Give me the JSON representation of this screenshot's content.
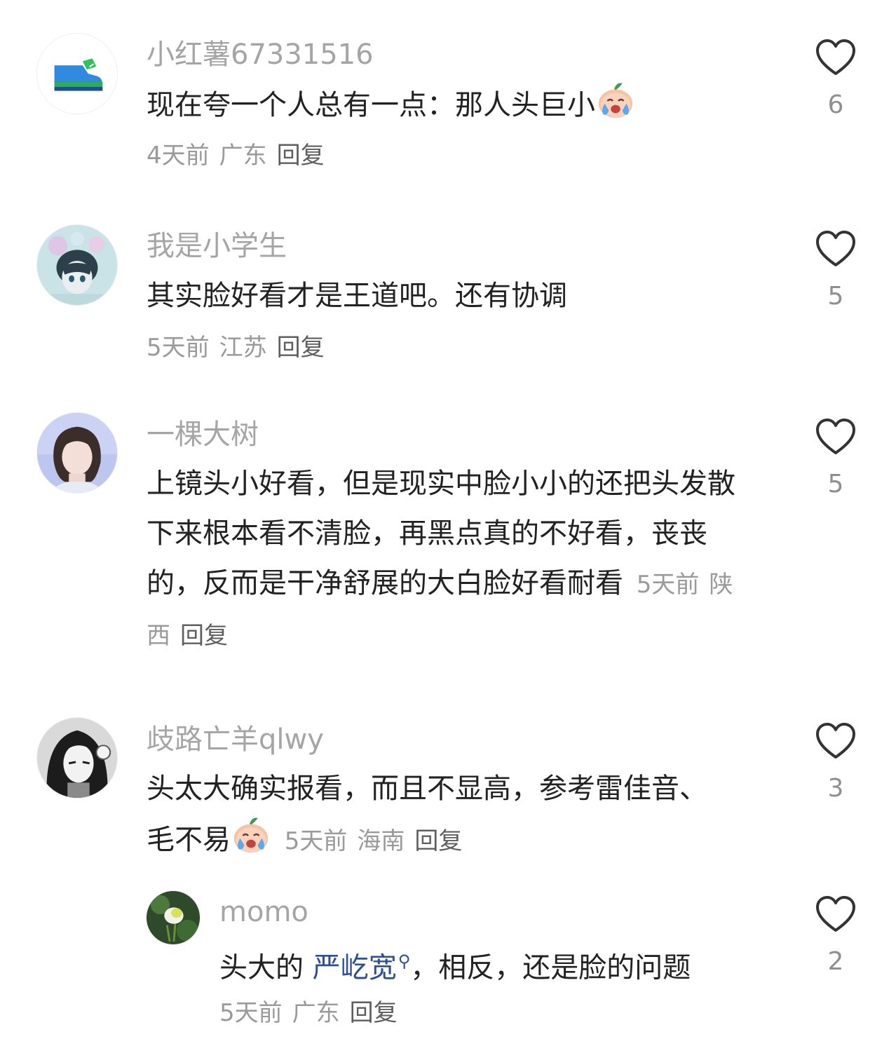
{
  "comments": [
    {
      "username": "小红薯67331516",
      "text": "现在夸一个人总有一点：那人头巨小",
      "time": "4天前",
      "location": "广东",
      "reply": "回复",
      "likes": "6",
      "avatar_icon": "sneaker-icon"
    },
    {
      "username": "我是小学生",
      "text": "其实脸好看才是王道吧。还有协调",
      "time": "5天前",
      "location": "江苏",
      "reply": "回复",
      "likes": "5",
      "avatar_icon": "anime-boy-avatar"
    },
    {
      "username": "一棵大树",
      "text": "上镜头小好看，但是现实中脸小小的还把头发散下来根本看不清脸，再黑点真的不好看，丧丧的，反而是干净舒展的大白脸好看耐看",
      "time": "5天前",
      "location": "陕西",
      "reply": "回复",
      "likes": "5",
      "avatar_icon": "girl-photo-avatar"
    },
    {
      "username": "歧路亡羊qlwy",
      "text": "头太大确实报看，而且不显高，参考雷佳音、毛不易",
      "time": "5天前",
      "location": "海南",
      "reply": "回复",
      "likes": "3",
      "avatar_icon": "manga-girl-avatar"
    }
  ],
  "reply_comment": {
    "username": "momo",
    "text_before": "头大的 ",
    "mention": "严屹宽",
    "text_after": "，相反，还是脸的问题",
    "time": "5天前",
    "location": "广东",
    "reply": "回复",
    "likes": "2",
    "avatar_icon": "flower-avatar"
  },
  "colors": {
    "username": "#a5a5a5",
    "text": "#222222",
    "meta": "#9a9a9a",
    "mention": "#2f4f91"
  },
  "emoji_icon": "crying-peach-emoji"
}
